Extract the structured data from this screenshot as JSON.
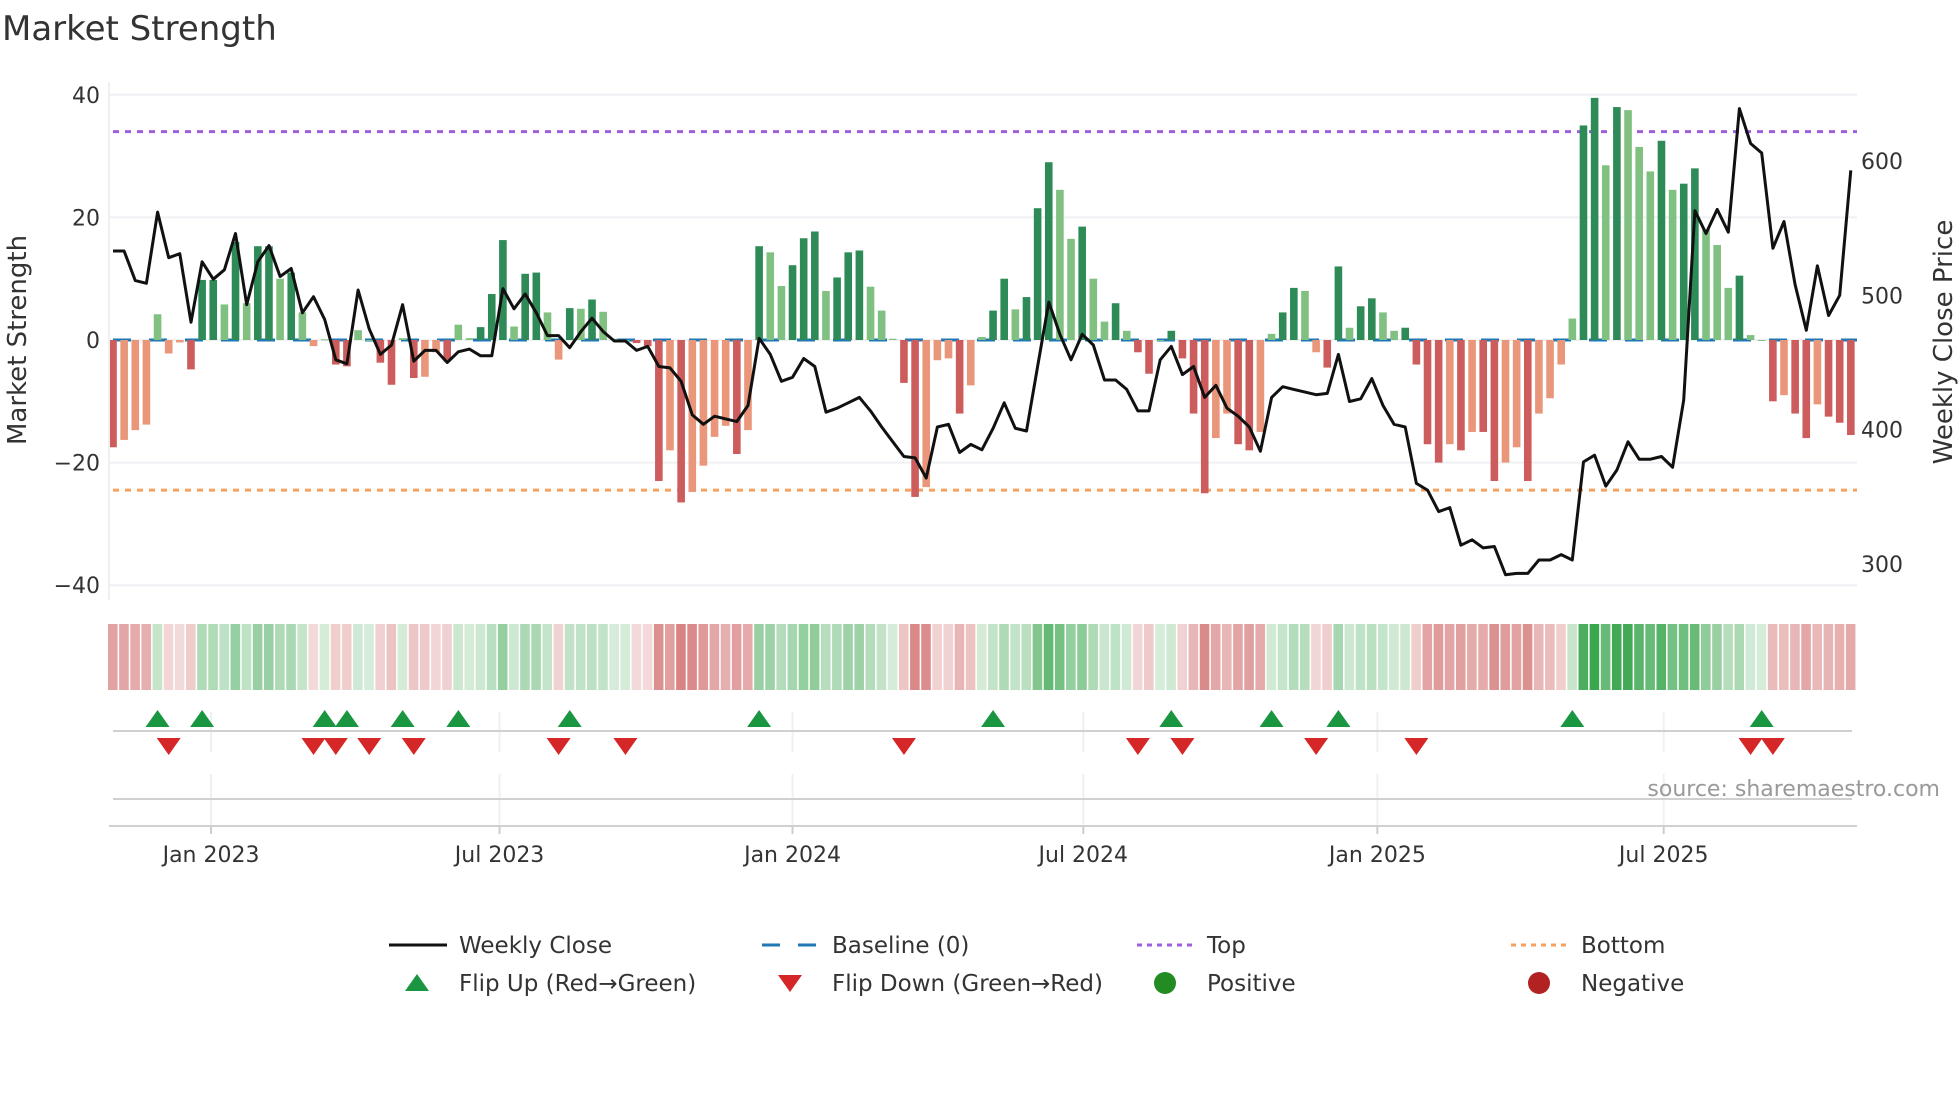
{
  "title": "Market Strength",
  "source": "source: sharemaestro.com",
  "chart_data": {
    "type": "bar",
    "title": "Market Strength",
    "ylabel": "Market Strength",
    "y2label": "Weekly Close Price",
    "ylim": [
      -42,
      42
    ],
    "y2lim": [
      280,
      660
    ],
    "yticks": [
      {
        "v": 40,
        "label": "40"
      },
      {
        "v": 20,
        "label": "20"
      },
      {
        "v": 0,
        "label": "0"
      },
      {
        "v": -20,
        "label": "−20"
      },
      {
        "v": -40,
        "label": "−40"
      }
    ],
    "y2ticks": [
      {
        "v": 600,
        "label": "600"
      },
      {
        "v": 500,
        "label": "500"
      },
      {
        "v": 400,
        "label": "400"
      },
      {
        "v": 300,
        "label": "300"
      }
    ],
    "xticks": [
      {
        "week": 8.8,
        "label": "Jan 2023"
      },
      {
        "week": 34.7,
        "label": "Jul 2023"
      },
      {
        "week": 61.0,
        "label": "Jan 2024"
      },
      {
        "week": 87.1,
        "label": "Jul 2024"
      },
      {
        "week": 113.5,
        "label": "Jan 2025"
      },
      {
        "week": 139.2,
        "label": "Jul 2025"
      }
    ],
    "top_level": 34,
    "bottom_level": -24.5,
    "baseline": 0,
    "strength": [
      -17.5,
      -16.3,
      -14.7,
      -13.8,
      4.2,
      -2.2,
      -0.4,
      -4.8,
      9.8,
      9.8,
      5.8,
      16,
      6,
      15.3,
      15.3,
      10,
      11,
      4.5,
      -1,
      0.1,
      -4,
      -4.3,
      1.6,
      0,
      -3.7,
      -7.3,
      0.3,
      -6.2,
      -6,
      -2,
      -3.5,
      2.5,
      0.3,
      2.1,
      7.5,
      16.3,
      2.2,
      10.8,
      11,
      4.5,
      -3.2,
      5.2,
      5.1,
      6.6,
      4.6,
      0.2,
      0,
      -0.5,
      -1,
      -23,
      -18,
      -26.5,
      -24.8,
      -20.5,
      -15.8,
      -14,
      -18.6,
      -14.7,
      15.3,
      14.3,
      8.8,
      12.2,
      16.6,
      17.7,
      8,
      10.2,
      14.3,
      14.6,
      8.7,
      4.8,
      0.2,
      -7,
      -25.6,
      -24,
      -3.3,
      -3,
      -12,
      -7.4,
      0.5,
      4.8,
      10,
      5,
      7,
      21.5,
      29,
      24.5,
      16.5,
      18.5,
      10,
      3,
      6,
      1.5,
      -2,
      -5.5,
      0,
      1.5,
      -3,
      -12,
      -25,
      -16,
      -12,
      -17,
      -18,
      -15,
      1,
      4.5,
      8.5,
      8,
      -2,
      -4.5,
      12,
      2,
      5.5,
      6.8,
      4.5,
      1.5,
      2,
      -4,
      -17,
      -20,
      -17,
      -18,
      -15,
      -15,
      -23,
      -20,
      -17.5,
      -23,
      -12,
      -9.5,
      -4,
      3.5,
      35,
      39.5,
      28.5,
      38,
      37.5,
      31.5,
      27.5,
      32.5,
      24.5,
      25.5,
      28,
      18,
      15.5,
      8.5,
      10.5,
      0.8,
      0,
      -10,
      -9,
      -12,
      -16,
      -10.5,
      -12.5,
      -13.5,
      -15.5
    ],
    "weekly_close": [
      533,
      533,
      511,
      509,
      562,
      528,
      531,
      480,
      525,
      512,
      519,
      546,
      493,
      525,
      537,
      514,
      520,
      487,
      499,
      482,
      452,
      449,
      504,
      475,
      456,
      463,
      493,
      451,
      459,
      459,
      450,
      458,
      460,
      455,
      455,
      505,
      490,
      501,
      487,
      470,
      470,
      461,
      473,
      483,
      473,
      466,
      466,
      459,
      462,
      447,
      446,
      436,
      411,
      404,
      410,
      408,
      406,
      418,
      468,
      456,
      436,
      439,
      453,
      447,
      413,
      416,
      420,
      424,
      414,
      402,
      391,
      380,
      379,
      364,
      402,
      404,
      383,
      389,
      385,
      401,
      420,
      401,
      399,
      447,
      495,
      471,
      452,
      471,
      463,
      437,
      437,
      430,
      414,
      414,
      452,
      462,
      441,
      447,
      424,
      433,
      416,
      410,
      402,
      384,
      424,
      432,
      430,
      428,
      426,
      427,
      456,
      421,
      423,
      438,
      418,
      404,
      402,
      360,
      355,
      339,
      342,
      314,
      318,
      312,
      313,
      292,
      293,
      293,
      303,
      303,
      307,
      303,
      376,
      381,
      358,
      370,
      391,
      378,
      378,
      380,
      372,
      422,
      563,
      546,
      564,
      547,
      639,
      613,
      606,
      535,
      555,
      508,
      474,
      522,
      485,
      500,
      593
    ],
    "flip_up_weeks": [
      4,
      8,
      19,
      21,
      26,
      31,
      41,
      58,
      79,
      95,
      104,
      110,
      131,
      148
    ],
    "flip_down_weeks": [
      5,
      18,
      20,
      23,
      27,
      40,
      46,
      71,
      92,
      96,
      108,
      117,
      147,
      149
    ],
    "legend": {
      "placement": "bottom",
      "items": [
        {
          "label": "Weekly Close",
          "kind": "line",
          "color": "#111111"
        },
        {
          "label": "Baseline (0)",
          "kind": "dash",
          "color": "#1f77b4"
        },
        {
          "label": "Top",
          "kind": "dot",
          "color": "#9d5fe0"
        },
        {
          "label": "Bottom",
          "kind": "dot",
          "color": "#f4a261"
        },
        {
          "label": "Flip Up (Red→Green)",
          "kind": "up",
          "color": "#1a9641"
        },
        {
          "label": "Flip Down (Green→Red)",
          "kind": "down",
          "color": "#d62728"
        },
        {
          "label": "Positive",
          "kind": "circle",
          "color": "#228b22"
        },
        {
          "label": "Negative",
          "kind": "circle",
          "color": "#b22222"
        }
      ]
    },
    "colors": {
      "pos_dark": "#2e8b57",
      "pos_light": "#80c080",
      "neg_dark": "#cd5c5c",
      "neg_light": "#e9967a",
      "strip_pos": "46,160,67",
      "strip_neg": "200,80,80"
    }
  }
}
